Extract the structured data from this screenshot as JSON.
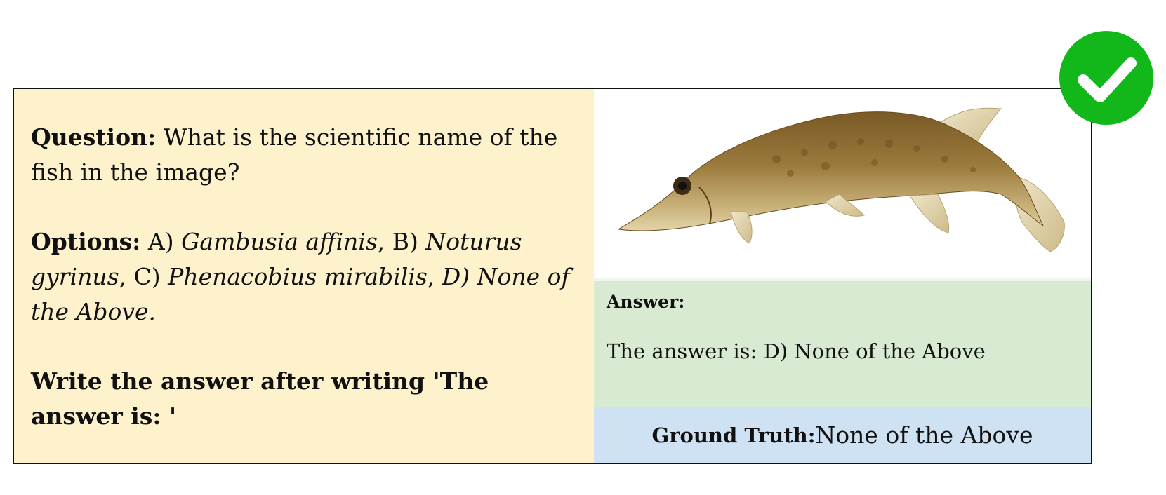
{
  "question": {
    "label": "Question:",
    "text": " What is the scientific name of the fish in the image?"
  },
  "options": {
    "label": "Options:",
    "parts": [
      {
        "text": " A) ",
        "italic": false
      },
      {
        "text": "Gambusia affinis",
        "italic": true
      },
      {
        "text": ", B) ",
        "italic": false
      },
      {
        "text": "Noturus gyrinus",
        "italic": true
      },
      {
        "text": ", C) ",
        "italic": false
      },
      {
        "text": "Phenacobius mirabilis",
        "italic": true
      },
      {
        "text": ", ",
        "italic": false
      },
      {
        "text": "D) None of the Above.",
        "italic": true
      }
    ]
  },
  "instruction": "Write the answer after writing 'The answer is: '",
  "answer": {
    "label": "Answer:",
    "text": "The answer is: D) None of the Above"
  },
  "ground_truth": {
    "label": "Ground Truth:",
    "value": " None of the Above"
  },
  "image": {
    "subject": "fish-photo"
  },
  "badge": {
    "icon": "checkmark-icon"
  },
  "colors": {
    "question_bg": "#fef2cd",
    "answer_bg": "#d9ead3",
    "ground_truth_bg": "#cfe2f3",
    "badge_green": "#12b81a",
    "border": "#111111"
  }
}
